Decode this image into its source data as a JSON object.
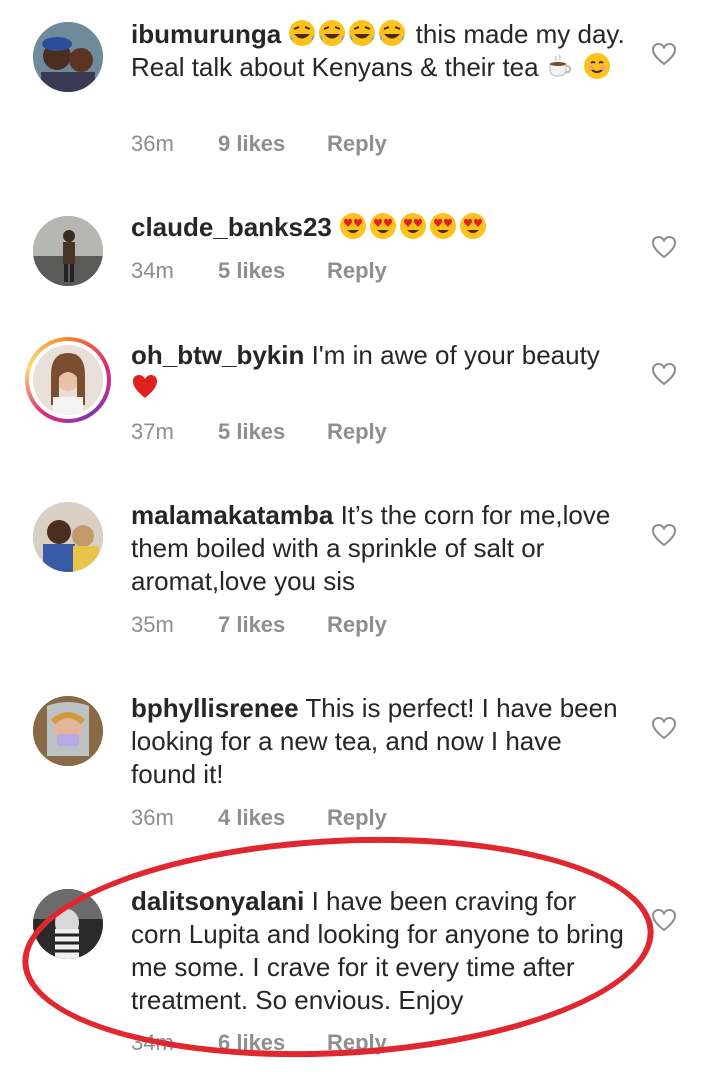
{
  "comments": [
    {
      "username": "ibumurunga",
      "text_before": "",
      "text": " this made my day. Real talk about Kenyans & their tea ",
      "time": "36m",
      "likes": "9 likes",
      "reply": "Reply"
    },
    {
      "username": "claude_banks23",
      "text": "",
      "time": "34m",
      "likes": "5 likes",
      "reply": "Reply"
    },
    {
      "username": "oh_btw_bykin",
      "text": " I'm in awe of your beauty ",
      "time": "37m",
      "likes": "5 likes",
      "reply": "Reply"
    },
    {
      "username": "malamakatamba",
      "text": " It’s the corn for me,love them boiled with a sprinkle of salt or aromat,love you sis",
      "time": "35m",
      "likes": "7 likes",
      "reply": "Reply"
    },
    {
      "username": "bphyllisrenee",
      "text": " This is perfect! I have been looking for a new tea, and now I have found it!",
      "time": "36m",
      "likes": "4 likes",
      "reply": "Reply"
    },
    {
      "username": "dalitsonyalani",
      "text": " I have been craving for corn Lupita and looking for anyone to bring me some. I crave for it every time after treatment. So envious. Enjoy",
      "time": "34m",
      "likes": "6 likes",
      "reply": "Reply"
    }
  ],
  "colors": {
    "text": "#262626",
    "meta": "#8e8e8e",
    "highlight": "#e0262e",
    "heart_emoji": "#e0201f"
  },
  "icons": [
    "heart-outline-icon",
    "rofl-emoji",
    "heart-eyes-emoji",
    "smile-emoji",
    "tea-emoji",
    "red-heart-emoji"
  ]
}
